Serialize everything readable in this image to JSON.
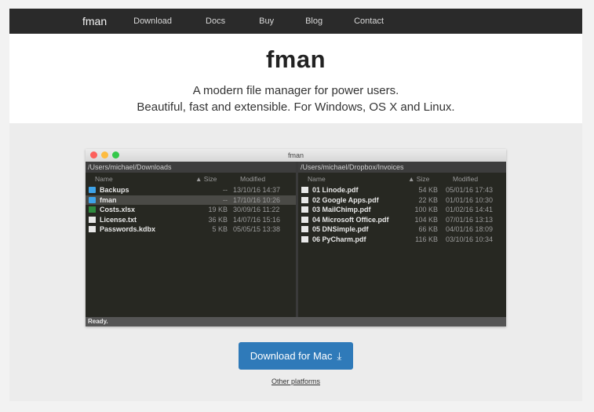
{
  "nav": {
    "logo": "fman",
    "items": [
      "Download",
      "Docs",
      "Buy",
      "Blog",
      "Contact"
    ]
  },
  "hero": {
    "title": "fman",
    "tagline1": "A modern file manager for power users.",
    "tagline2": "Beautiful, fast and extensible. For Windows, OS X and Linux."
  },
  "app": {
    "window_title": "fman",
    "left": {
      "path": "/Users/michael/Downloads",
      "headers": {
        "name": "Name",
        "size": "▲ Size",
        "modified": "Modified"
      },
      "rows": [
        {
          "name": "Backups",
          "size": "--",
          "modified": "13/10/16 14:37",
          "icon": "folder-icon"
        },
        {
          "name": "fman",
          "size": "--",
          "modified": "17/10/16 10:26",
          "icon": "folder-icon"
        },
        {
          "name": "Costs.xlsx",
          "size": "19 KB",
          "modified": "30/09/16 11:22",
          "icon": "spreadsheet-icon"
        },
        {
          "name": "License.txt",
          "size": "36 KB",
          "modified": "14/07/16 15:16",
          "icon": "text-file-icon"
        },
        {
          "name": "Passwords.kdbx",
          "size": "5 KB",
          "modified": "05/05/15 13:38",
          "icon": "file-icon"
        }
      ]
    },
    "right": {
      "path": "/Users/michael/Dropbox/Invoices",
      "headers": {
        "name": "Name",
        "size": "▲ Size",
        "modified": "Modified"
      },
      "rows": [
        {
          "name": "01 Linode.pdf",
          "size": "54 KB",
          "modified": "05/01/16 17:43",
          "icon": "pdf-icon"
        },
        {
          "name": "02 Google Apps.pdf",
          "size": "22 KB",
          "modified": "01/01/16 10:30",
          "icon": "pdf-icon"
        },
        {
          "name": "03 MailChimp.pdf",
          "size": "100 KB",
          "modified": "01/02/16 14:41",
          "icon": "pdf-icon"
        },
        {
          "name": "04 Microsoft Office.pdf",
          "size": "104 KB",
          "modified": "07/01/16 13:13",
          "icon": "pdf-icon"
        },
        {
          "name": "05 DNSimple.pdf",
          "size": "66 KB",
          "modified": "04/01/16 18:09",
          "icon": "pdf-icon"
        },
        {
          "name": "06 PyCharm.pdf",
          "size": "116 KB",
          "modified": "03/10/16 10:34",
          "icon": "pdf-icon"
        }
      ]
    },
    "status": "Ready."
  },
  "cta": {
    "download_label": "Download for Mac",
    "download_icon": "download-icon",
    "other_label": "Other platforms"
  },
  "colors": {
    "nav_bg": "#2a2a2a",
    "button_bg": "#2f7ab9",
    "gray_section": "#ececec"
  }
}
